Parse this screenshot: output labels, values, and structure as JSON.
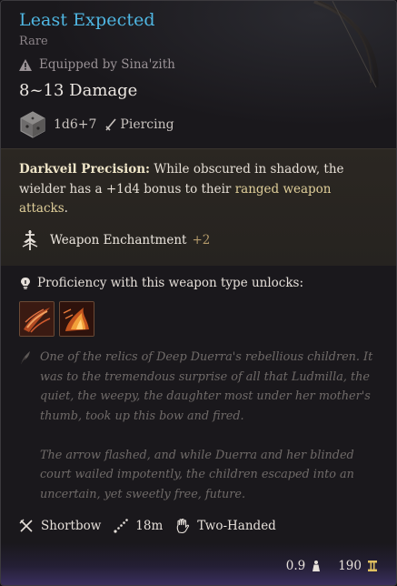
{
  "item": {
    "name": "Least Expected",
    "rarity": "Rare",
    "equipped_by": "Equipped by Sina'zith",
    "damage": "8~13 Damage",
    "dice": "1d6+7",
    "damage_type": "Piercing"
  },
  "passive": {
    "name": "Darkveil Precision:",
    "text_1": " While obscured in shadow, the wielder has a +1d4 bonus to their ",
    "highlight": "ranged weapon attacks",
    "text_2": "."
  },
  "enchantment": {
    "label": "Weapon Enchantment",
    "bonus": "+2"
  },
  "proficiency": {
    "label": "Proficiency with this weapon type unlocks:",
    "actions": [
      "action-icon-1",
      "action-icon-2"
    ]
  },
  "lore": {
    "p1": "One of the relics of Deep Duerra's rebellious children. It was to the tremendous surprise of all that Ludmilla, the quiet, the weepy, the daughter most under her mother's thumb, took up this bow and fired.",
    "p2": "The arrow flashed, and while Duerra and her blinded court wailed impotently, the children escaped into an uncertain, yet sweetly free, future."
  },
  "properties": {
    "type": "Shortbow",
    "range": "18m",
    "handedness": "Two-Handed"
  },
  "footer": {
    "weight": "0.9",
    "value": "190"
  },
  "colors": {
    "title": "#4fb6e2",
    "highlight": "#e0cf9a",
    "bonus": "#b49a6a"
  }
}
